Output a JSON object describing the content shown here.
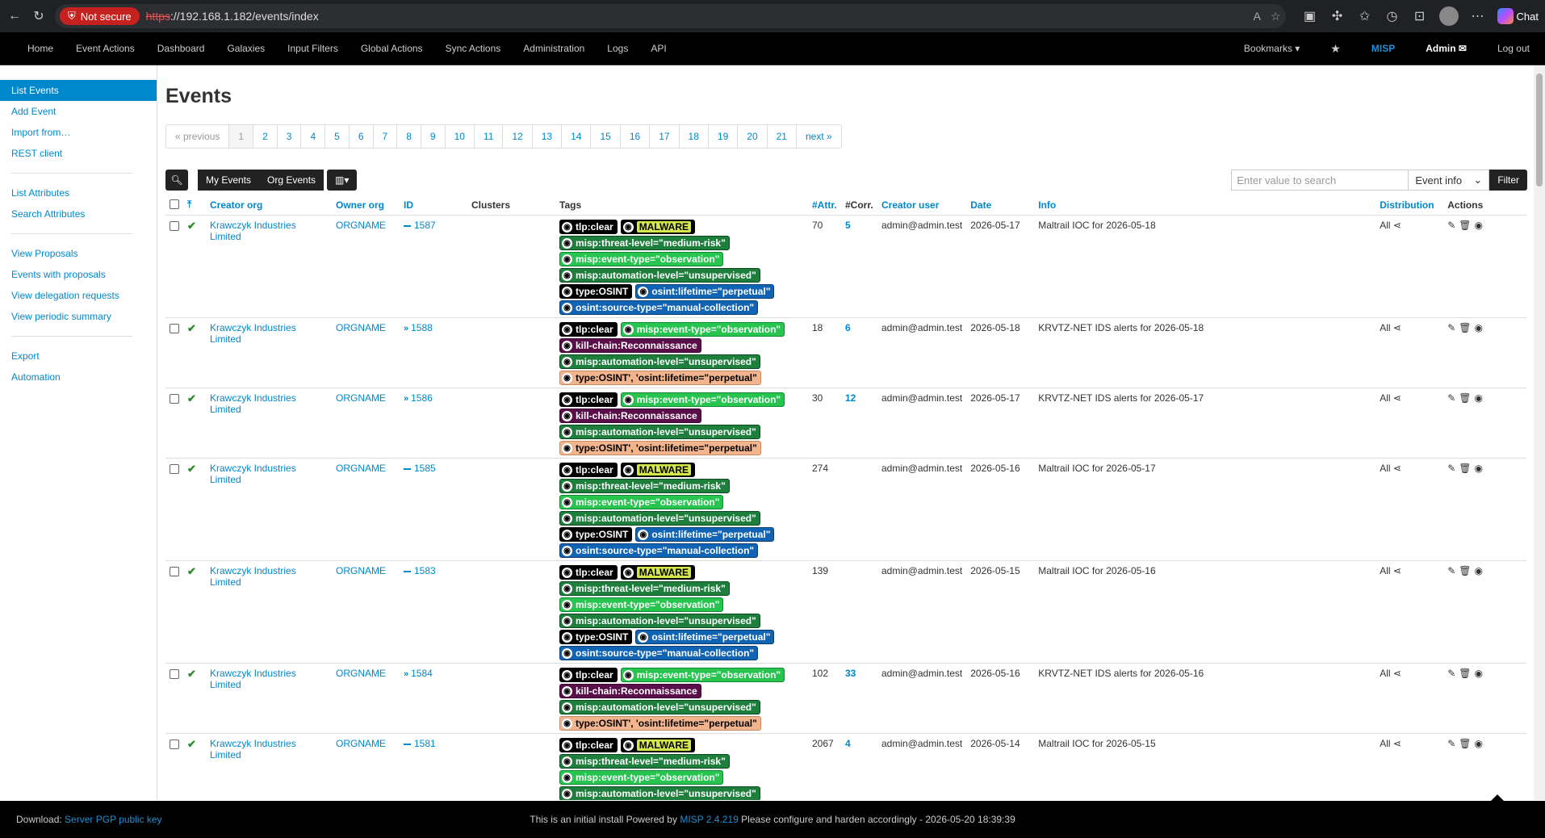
{
  "browser": {
    "not_secure": "Not secure",
    "url_scheme": "https",
    "url_rest": "://192.168.1.182/events/index",
    "chat": "Chat"
  },
  "nav": {
    "items": [
      "Home",
      "Event Actions",
      "Dashboard",
      "Galaxies",
      "Input Filters",
      "Global Actions",
      "Sync Actions",
      "Administration",
      "Logs",
      "API"
    ],
    "bookmarks": "Bookmarks ▾",
    "brand": "MISP",
    "user": "Admin",
    "logout": "Log out"
  },
  "sidebar": {
    "group1": [
      "List Events",
      "Add Event",
      "Import from…",
      "REST client"
    ],
    "group2": [
      "List Attributes",
      "Search Attributes"
    ],
    "group3": [
      "View Proposals",
      "Events with proposals",
      "View delegation requests",
      "View periodic summary"
    ],
    "group4": [
      "Export",
      "Automation"
    ]
  },
  "page": {
    "title": "Events",
    "prev": "« previous",
    "next": "next »",
    "pages": [
      "1",
      "2",
      "3",
      "4",
      "5",
      "6",
      "7",
      "8",
      "9",
      "10",
      "11",
      "12",
      "13",
      "14",
      "15",
      "16",
      "17",
      "18",
      "19",
      "20",
      "21"
    ],
    "my_events": "My Events",
    "org_events": "Org Events",
    "search_placeholder": "Enter value to search",
    "search_field": "Event info",
    "filter": "Filter"
  },
  "table": {
    "headers": {
      "creator_org": "Creator org",
      "owner_org": "Owner org",
      "id": "ID",
      "clusters": "Clusters",
      "tags": "Tags",
      "attr": "#Attr.",
      "corr": "#Corr.",
      "creator_user": "Creator user",
      "date": "Date",
      "info": "Info",
      "distribution": "Distribution",
      "actions": "Actions"
    },
    "rows": [
      {
        "creator": "Krawczyk Industries Limited",
        "owner": "ORGNAME",
        "id": "1587",
        "threat": "dash",
        "attr": "70",
        "corr": "5",
        "user": "admin@admin.test",
        "date": "2026-05-17",
        "info": "Maltrail IOC for 2026-05-18",
        "dist": "All",
        "tagset": "A"
      },
      {
        "creator": "Krawczyk Industries Limited",
        "owner": "ORGNAME",
        "id": "1588",
        "threat": "chev",
        "attr": "18",
        "corr": "6",
        "user": "admin@admin.test",
        "date": "2026-05-18",
        "info": "KRVTZ-NET IDS alerts for 2026-05-18",
        "dist": "All",
        "tagset": "B"
      },
      {
        "creator": "Krawczyk Industries Limited",
        "owner": "ORGNAME",
        "id": "1586",
        "threat": "chev",
        "attr": "30",
        "corr": "12",
        "user": "admin@admin.test",
        "date": "2026-05-17",
        "info": "KRVTZ-NET IDS alerts for 2026-05-17",
        "dist": "All",
        "tagset": "B"
      },
      {
        "creator": "Krawczyk Industries Limited",
        "owner": "ORGNAME",
        "id": "1585",
        "threat": "dash",
        "attr": "274",
        "corr": "",
        "user": "admin@admin.test",
        "date": "2026-05-16",
        "info": "Maltrail IOC for 2026-05-17",
        "dist": "All",
        "tagset": "A"
      },
      {
        "creator": "Krawczyk Industries Limited",
        "owner": "ORGNAME",
        "id": "1583",
        "threat": "dash",
        "attr": "139",
        "corr": "",
        "user": "admin@admin.test",
        "date": "2026-05-15",
        "info": "Maltrail IOC for 2026-05-16",
        "dist": "All",
        "tagset": "A"
      },
      {
        "creator": "Krawczyk Industries Limited",
        "owner": "ORGNAME",
        "id": "1584",
        "threat": "chev",
        "attr": "102",
        "corr": "33",
        "user": "admin@admin.test",
        "date": "2026-05-16",
        "info": "KRVTZ-NET IDS alerts for 2026-05-16",
        "dist": "All",
        "tagset": "B"
      },
      {
        "creator": "Krawczyk Industries Limited",
        "owner": "ORGNAME",
        "id": "1581",
        "threat": "dash",
        "attr": "2067",
        "corr": "4",
        "user": "admin@admin.test",
        "date": "2026-05-14",
        "info": "Maltrail IOC for 2026-05-15",
        "dist": "All",
        "tagset": "A"
      }
    ]
  },
  "tagsets": {
    "A": [
      [
        {
          "text": "tlp:clear",
          "style": "black"
        },
        {
          "text": "MALWARE",
          "style": "malware"
        }
      ],
      [
        {
          "text": "misp:threat-level=\"medium-risk\"",
          "style": "green-dark"
        }
      ],
      [
        {
          "text": "misp:event-type=\"observation\"",
          "style": "green"
        }
      ],
      [
        {
          "text": "misp:automation-level=\"unsupervised\"",
          "style": "green-dark"
        }
      ],
      [
        {
          "text": "type:OSINT",
          "style": "black"
        },
        {
          "text": "osint:lifetime=\"perpetual\"",
          "style": "blue"
        }
      ],
      [
        {
          "text": "osint:source-type=\"manual-collection\"",
          "style": "blue"
        }
      ]
    ],
    "B": [
      [
        {
          "text": "tlp:clear",
          "style": "black"
        },
        {
          "text": "misp:event-type=\"observation\"",
          "style": "green"
        }
      ],
      [
        {
          "text": "kill-chain:Reconnaissance",
          "style": "purple"
        }
      ],
      [
        {
          "text": "misp:automation-level=\"unsupervised\"",
          "style": "green-dark"
        }
      ],
      [
        {
          "text": "type:OSINT', 'osint:lifetime=\"perpetual\"",
          "style": "peach"
        }
      ]
    ]
  },
  "footer": {
    "download_label": "Download:",
    "download_link": "Server PGP public key",
    "powered_pre": "This is an initial install Powered by",
    "powered_link": "MISP 2.4.219",
    "powered_post": "Please configure and harden accordingly - 2026-05-20 18:39:39"
  },
  "colors": {
    "accent": "#0088cc",
    "nav_bg": "#000000",
    "tag_green": "#27c44f",
    "tag_blue": "#1164b4",
    "tag_purple": "#5a0f4a"
  }
}
